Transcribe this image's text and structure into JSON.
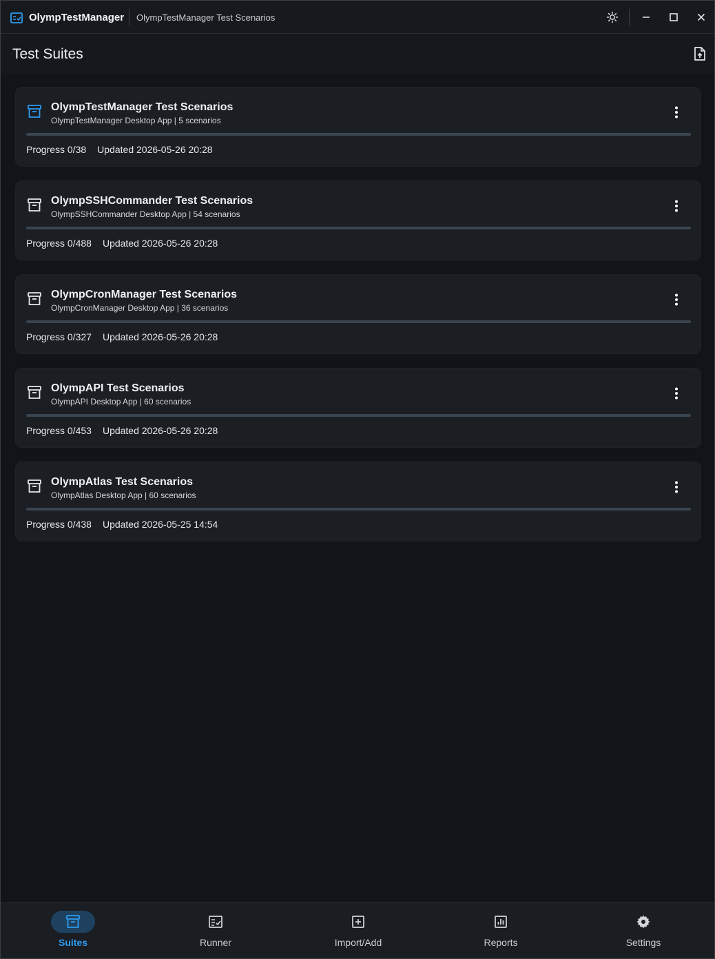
{
  "titlebar": {
    "app_name": "OlympTestManager",
    "subtitle": "OlympTestManager Test Scenarios",
    "icons": [
      "app-logo-icon",
      "theme-sun-icon",
      "minimize-icon",
      "maximize-icon",
      "close-icon"
    ]
  },
  "header": {
    "title": "Test Suites",
    "export_icon": "file-export-icon"
  },
  "colors": {
    "accent": "#1e90e8",
    "background": "#111418",
    "card": "#1b1e23",
    "nav_active_bg": "#1f4160",
    "progress_track": "#3a4552"
  },
  "suites": [
    {
      "title": "OlympTestManager Test Scenarios",
      "subtitle": "OlympTestManager Desktop App | 5 scenarios",
      "progress_label": "Progress 0/38",
      "updated_label": "Updated 2026-05-26 20:28",
      "progress_fraction": 0,
      "selected": true
    },
    {
      "title": "OlympSSHCommander Test Scenarios",
      "subtitle": "OlympSSHCommander Desktop App | 54 scenarios",
      "progress_label": "Progress 0/488",
      "updated_label": "Updated 2026-05-26 20:28",
      "progress_fraction": 0,
      "selected": false
    },
    {
      "title": "OlympCronManager Test Scenarios",
      "subtitle": "OlympCronManager Desktop App | 36 scenarios",
      "progress_label": "Progress 0/327",
      "updated_label": "Updated 2026-05-26 20:28",
      "progress_fraction": 0,
      "selected": false
    },
    {
      "title": "OlympAPI Test Scenarios",
      "subtitle": "OlympAPI Desktop App | 60 scenarios",
      "progress_label": "Progress 0/453",
      "updated_label": "Updated 2026-05-26 20:28",
      "progress_fraction": 0,
      "selected": false
    },
    {
      "title": "OlympAtlas Test Scenarios",
      "subtitle": "OlympAtlas Desktop App | 60 scenarios",
      "progress_label": "Progress 0/438",
      "updated_label": "Updated 2026-05-25 14:54",
      "progress_fraction": 0,
      "selected": false
    }
  ],
  "nav": {
    "items": [
      {
        "label": "Suites",
        "icon": "archive-box-icon",
        "active": true
      },
      {
        "label": "Runner",
        "icon": "checklist-icon",
        "active": false
      },
      {
        "label": "Import/Add",
        "icon": "plus-square-icon",
        "active": false
      },
      {
        "label": "Reports",
        "icon": "bar-chart-icon",
        "active": false
      },
      {
        "label": "Settings",
        "icon": "gear-icon",
        "active": false
      }
    ]
  }
}
